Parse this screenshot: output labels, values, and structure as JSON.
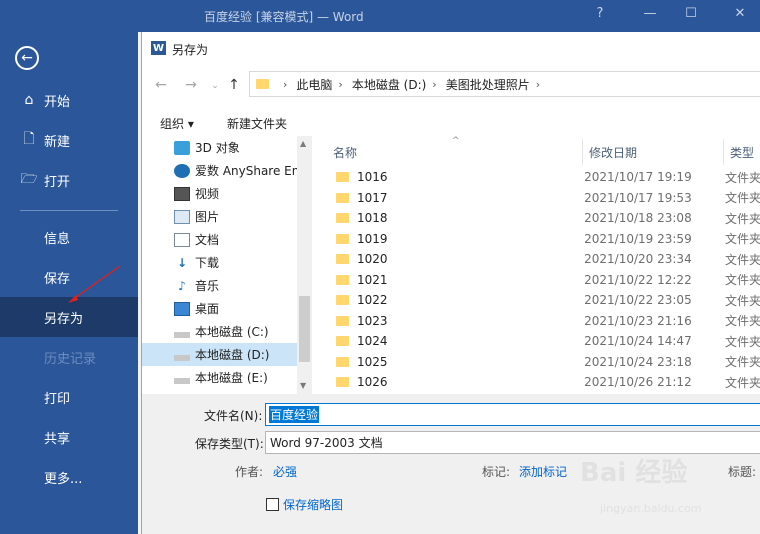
{
  "window": {
    "title": "百度经验 [兼容模式] — Word",
    "controls": [
      "?",
      "—",
      "☐",
      "✕"
    ]
  },
  "sidebar": {
    "back_icon": "back-arrow-icon",
    "items": [
      {
        "label": "开始",
        "icon": "home-icon"
      },
      {
        "label": "新建",
        "icon": "new-document-icon"
      },
      {
        "label": "打开",
        "icon": "open-folder-icon"
      },
      {
        "label": "信息"
      },
      {
        "label": "保存"
      },
      {
        "label": "另存为"
      },
      {
        "label": "历史记录"
      },
      {
        "label": "打印"
      },
      {
        "label": "共享"
      },
      {
        "label": "更多..."
      }
    ],
    "active": "另存为",
    "accent": "#2b579a"
  },
  "dialog": {
    "title": "另存为",
    "breadcrumb": [
      "此电脑",
      "本地磁盘 (D:)",
      "美图批处理照片"
    ],
    "toolbar": {
      "organize": "组织 ▾",
      "new_folder": "新建文件夹"
    },
    "tree": [
      {
        "label": "3D 对象",
        "icon": "3d-objects-icon"
      },
      {
        "label": "爱数 AnyShare Ent",
        "icon": "cloud-icon"
      },
      {
        "label": "视频",
        "icon": "video-icon"
      },
      {
        "label": "图片",
        "icon": "picture-icon"
      },
      {
        "label": "文档",
        "icon": "document-icon"
      },
      {
        "label": "下载",
        "icon": "download-icon"
      },
      {
        "label": "音乐",
        "icon": "music-icon"
      },
      {
        "label": "桌面",
        "icon": "desktop-icon"
      },
      {
        "label": "本地磁盘 (C:)",
        "icon": "drive-icon"
      },
      {
        "label": "本地磁盘 (D:)",
        "icon": "drive-icon"
      },
      {
        "label": "本地磁盘 (E:)",
        "icon": "drive-icon"
      }
    ],
    "tree_selected": "本地磁盘 (D:)",
    "columns": {
      "name": "名称",
      "date": "修改日期",
      "type": "类型"
    },
    "files": [
      {
        "name": "1016",
        "date": "2021/10/17 19:19",
        "type": "文件夹"
      },
      {
        "name": "1017",
        "date": "2021/10/17 19:53",
        "type": "文件夹"
      },
      {
        "name": "1018",
        "date": "2021/10/18 23:08",
        "type": "文件夹"
      },
      {
        "name": "1019",
        "date": "2021/10/19 23:59",
        "type": "文件夹"
      },
      {
        "name": "1020",
        "date": "2021/10/20 23:34",
        "type": "文件夹"
      },
      {
        "name": "1021",
        "date": "2021/10/22 12:22",
        "type": "文件夹"
      },
      {
        "name": "1022",
        "date": "2021/10/22 23:05",
        "type": "文件夹"
      },
      {
        "name": "1023",
        "date": "2021/10/23 21:16",
        "type": "文件夹"
      },
      {
        "name": "1024",
        "date": "2021/10/24 14:47",
        "type": "文件夹"
      },
      {
        "name": "1025",
        "date": "2021/10/24 23:18",
        "type": "文件夹"
      },
      {
        "name": "1026",
        "date": "2021/10/26 21:12",
        "type": "文件夹"
      }
    ],
    "filename_label": "文件名(N):",
    "filename_value": "百度经验",
    "savetype_label": "保存类型(T):",
    "savetype_value": "Word 97-2003 文档",
    "author_label": "作者:",
    "author_value": "必强",
    "tags_label": "标记:",
    "tags_value": "添加标记",
    "title_label": "标题:",
    "thumbnail_label": "保存缩略图"
  },
  "watermark": {
    "text": "Bai 经验",
    "url": "jingyan.baidu.com"
  }
}
